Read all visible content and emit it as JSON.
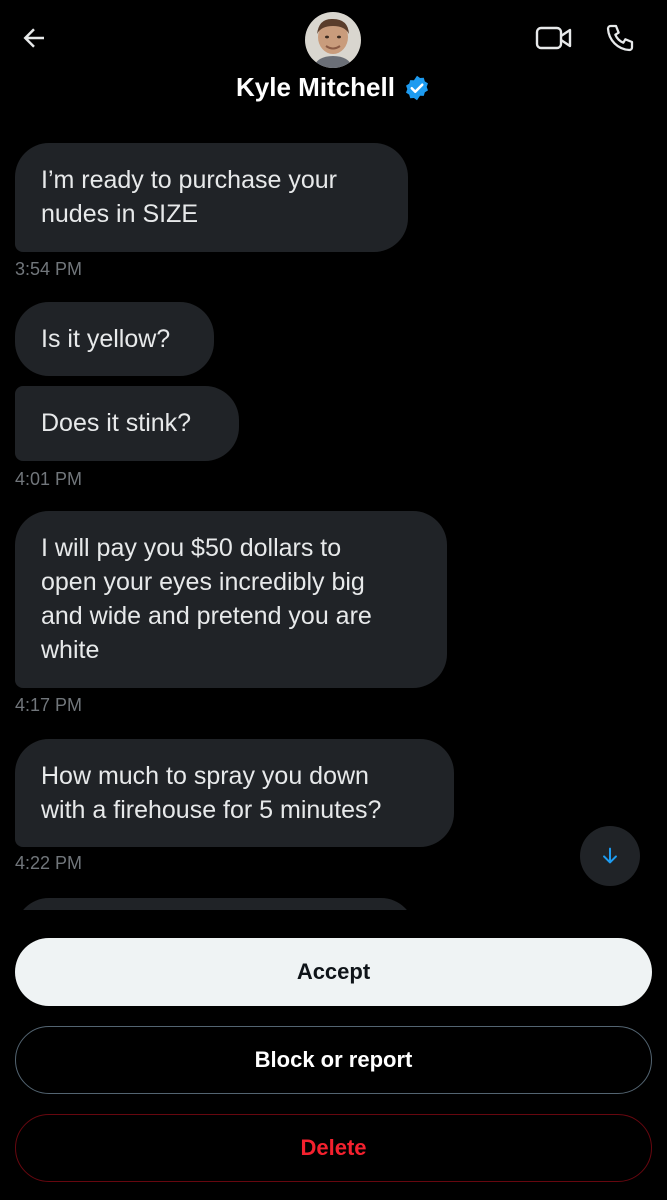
{
  "header": {
    "contact_name": "Kyle Mitchell",
    "icons": {
      "back": "arrow-left-icon",
      "video": "video-camera-icon",
      "phone": "phone-icon",
      "verified": "verified-badge-icon"
    },
    "accent_color": "#1d9bf0"
  },
  "messages": [
    {
      "lines": [
        "I’m ready to purchase your",
        "nudes in SIZE"
      ]
    },
    {
      "lines": [
        "Is it yellow?"
      ]
    },
    {
      "lines": [
        "Does it stink?"
      ]
    },
    {
      "lines": [
        "I will pay you $50 dollars to",
        "open your eyes incredibly big",
        "and wide and pretend you are",
        "white"
      ]
    },
    {
      "lines": [
        "How much to spray you down",
        "with a firehouse for 5 minutes?"
      ]
    }
  ],
  "timestamps": [
    "3:54 PM",
    "4:01 PM",
    "4:17 PM",
    "4:22 PM"
  ],
  "actions": {
    "accept_label": "Accept",
    "block_label": "Block or report",
    "delete_label": "Delete"
  },
  "colors": {
    "background": "#000000",
    "bubble": "#202327",
    "delete": "#f4212e"
  }
}
